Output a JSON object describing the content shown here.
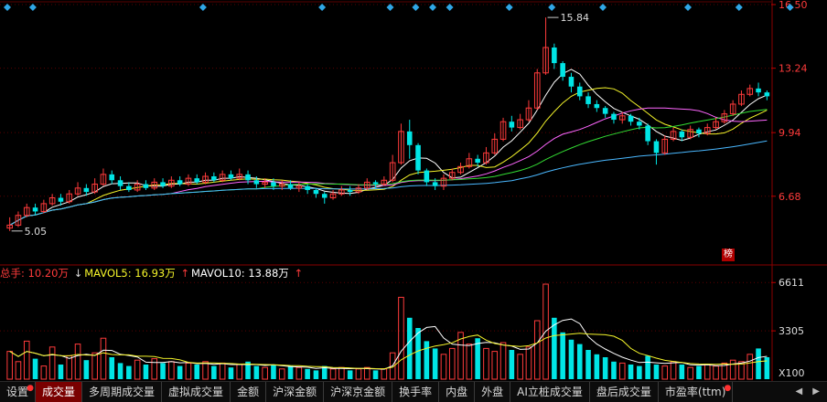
{
  "chart_data": {
    "type": "candlestick+volume",
    "price_axis": {
      "ticks": [
        16.5,
        13.24,
        9.94,
        6.68
      ],
      "labels": [
        "16.50",
        "13.24",
        "9.94",
        "6.68"
      ]
    },
    "annotations": {
      "high_label": "15.84",
      "low_label": "5.05"
    },
    "candles": [
      [
        5.05,
        5.2,
        5.6,
        4.9
      ],
      [
        5.2,
        5.7,
        5.9,
        5.1
      ],
      [
        5.7,
        6.1,
        6.3,
        5.6
      ],
      [
        6.1,
        5.9,
        6.3,
        5.7
      ],
      [
        5.9,
        6.3,
        6.5,
        5.8
      ],
      [
        6.3,
        6.6,
        6.8,
        6.2
      ],
      [
        6.6,
        6.4,
        6.8,
        6.2
      ],
      [
        6.4,
        6.8,
        7.0,
        6.3
      ],
      [
        6.8,
        7.1,
        7.4,
        6.7
      ],
      [
        7.1,
        6.9,
        7.3,
        6.7
      ],
      [
        6.9,
        7.3,
        7.6,
        6.8
      ],
      [
        7.3,
        7.8,
        8.1,
        7.2
      ],
      [
        7.8,
        7.5,
        8.0,
        7.3
      ],
      [
        7.5,
        7.2,
        7.7,
        7.0
      ],
      [
        7.2,
        7.0,
        7.4,
        6.9
      ],
      [
        7.0,
        7.3,
        7.5,
        6.9
      ],
      [
        7.3,
        7.1,
        7.5,
        7.0
      ],
      [
        7.1,
        7.4,
        7.6,
        7.0
      ],
      [
        7.4,
        7.2,
        7.6,
        7.1
      ],
      [
        7.2,
        7.5,
        7.7,
        7.1
      ],
      [
        7.5,
        7.3,
        7.7,
        7.2
      ],
      [
        7.3,
        7.6,
        7.8,
        7.2
      ],
      [
        7.6,
        7.4,
        7.8,
        7.3
      ],
      [
        7.4,
        7.7,
        7.9,
        7.3
      ],
      [
        7.7,
        7.5,
        7.9,
        7.4
      ],
      [
        7.5,
        7.8,
        8.0,
        7.4
      ],
      [
        7.8,
        7.6,
        8.0,
        7.5
      ],
      [
        7.6,
        7.8,
        8.1,
        7.5
      ],
      [
        7.8,
        7.5,
        8.0,
        7.3
      ],
      [
        7.5,
        7.3,
        7.7,
        7.1
      ],
      [
        7.3,
        7.4,
        7.6,
        7.1
      ],
      [
        7.4,
        7.2,
        7.6,
        7.0
      ],
      [
        7.2,
        7.3,
        7.5,
        7.0
      ],
      [
        7.3,
        7.1,
        7.5,
        7.0
      ],
      [
        7.1,
        7.2,
        7.4,
        6.9
      ],
      [
        7.2,
        7.0,
        7.3,
        6.8
      ],
      [
        7.0,
        6.8,
        7.1,
        6.6
      ],
      [
        6.8,
        6.6,
        6.9,
        6.3
      ],
      [
        6.6,
        6.8,
        7.0,
        6.5
      ],
      [
        6.8,
        7.0,
        7.2,
        6.7
      ],
      [
        7.0,
        6.9,
        7.2,
        6.7
      ],
      [
        6.9,
        7.1,
        7.3,
        6.8
      ],
      [
        7.1,
        7.4,
        7.6,
        7.0
      ],
      [
        7.4,
        7.3,
        7.5,
        7.1
      ],
      [
        7.3,
        7.5,
        7.7,
        7.2
      ],
      [
        7.5,
        8.4,
        8.8,
        7.4
      ],
      [
        8.4,
        10.0,
        10.4,
        8.3
      ],
      [
        10.0,
        9.3,
        10.6,
        8.6
      ],
      [
        9.3,
        8.0,
        9.4,
        7.8
      ],
      [
        8.0,
        7.4,
        8.1,
        7.2
      ],
      [
        7.4,
        7.2,
        7.6,
        7.0
      ],
      [
        7.2,
        7.6,
        7.8,
        7.0
      ],
      [
        7.6,
        7.9,
        8.1,
        7.5
      ],
      [
        7.9,
        8.2,
        8.4,
        7.8
      ],
      [
        8.2,
        8.6,
        8.9,
        8.1
      ],
      [
        8.6,
        8.4,
        8.8,
        8.2
      ],
      [
        8.4,
        8.9,
        9.2,
        8.3
      ],
      [
        8.9,
        9.6,
        9.9,
        8.8
      ],
      [
        9.6,
        10.5,
        10.7,
        9.5
      ],
      [
        10.5,
        10.2,
        10.8,
        10.0
      ],
      [
        10.2,
        10.6,
        10.9,
        10.1
      ],
      [
        10.6,
        11.2,
        11.6,
        10.5
      ],
      [
        11.2,
        13.0,
        13.2,
        11.1
      ],
      [
        13.0,
        14.3,
        15.84,
        12.9
      ],
      [
        14.3,
        13.5,
        14.5,
        13.2
      ],
      [
        13.5,
        12.8,
        13.6,
        12.6
      ],
      [
        12.8,
        12.3,
        13.0,
        12.0
      ],
      [
        12.3,
        11.8,
        12.5,
        11.6
      ],
      [
        11.8,
        11.4,
        12.0,
        11.2
      ],
      [
        11.4,
        11.2,
        11.6,
        11.0
      ],
      [
        11.2,
        10.9,
        11.3,
        10.7
      ],
      [
        10.9,
        10.6,
        11.0,
        10.4
      ],
      [
        10.6,
        10.8,
        11.0,
        10.4
      ],
      [
        10.8,
        10.5,
        10.9,
        10.3
      ],
      [
        10.5,
        10.3,
        10.7,
        10.1
      ],
      [
        10.3,
        9.5,
        10.4,
        9.3
      ],
      [
        9.5,
        8.9,
        9.6,
        8.3
      ],
      [
        8.9,
        9.6,
        9.8,
        8.8
      ],
      [
        9.6,
        10.0,
        10.2,
        9.5
      ],
      [
        10.0,
        9.7,
        10.1,
        9.5
      ],
      [
        9.7,
        10.1,
        10.3,
        9.6
      ],
      [
        10.1,
        9.9,
        10.2,
        9.7
      ],
      [
        9.9,
        10.2,
        10.4,
        9.8
      ],
      [
        10.2,
        10.5,
        10.7,
        10.1
      ],
      [
        10.5,
        10.9,
        11.1,
        10.4
      ],
      [
        10.9,
        11.4,
        11.6,
        10.8
      ],
      [
        11.4,
        11.9,
        12.1,
        11.3
      ],
      [
        11.9,
        12.2,
        12.4,
        11.8
      ],
      [
        12.2,
        12.0,
        12.5,
        11.8
      ],
      [
        12.0,
        11.8,
        12.1,
        11.6
      ]
    ],
    "volume": [
      1900,
      1200,
      2600,
      1400,
      900,
      2200,
      1000,
      1600,
      2400,
      1300,
      1800,
      2800,
      1500,
      1100,
      900,
      1300,
      1000,
      1400,
      1100,
      1200,
      900,
      1100,
      1000,
      1200,
      900,
      1100,
      800,
      1000,
      1200,
      900,
      800,
      1000,
      700,
      900,
      800,
      700,
      600,
      900,
      700,
      800,
      600,
      700,
      800,
      600,
      700,
      1800,
      5600,
      4200,
      3500,
      2600,
      2100,
      1700,
      2100,
      3200,
      2400,
      2800,
      2100,
      1900,
      2500,
      2000,
      1700,
      2200,
      4000,
      6500,
      4200,
      3200,
      2700,
      2400,
      2000,
      1700,
      1500,
      1200,
      1100,
      1000,
      900,
      1600,
      1000,
      900,
      1200,
      1000,
      800,
      900,
      1000,
      900,
      1100,
      1300,
      1200,
      1700,
      2100,
      1500
    ],
    "volume_axis": {
      "ticks": [
        6611,
        3305
      ],
      "labels": [
        "6611",
        "3305"
      ],
      "unit": "X100"
    },
    "volume_legend": {
      "total_label": "总手: 10.20万",
      "mavol5_label": "MAVOL5: 16.93万",
      "mavol5_arrow": "↓",
      "mavol10_label": "MAVOL10: 13.88万",
      "mavol10_arrow": "↑",
      "tail_arrow": "↑"
    },
    "colors": {
      "up": "#ff3b3b",
      "down": "#00e5e5",
      "ma_white": "#ffffff",
      "ma_yellow": "#f5f52a",
      "ma_pink": "#ff66ff",
      "ma_green": "#33dd33",
      "ma_blue": "#4ab8ff",
      "axis_label": "#ff3b3b",
      "event_marker": "#2fa6e6"
    },
    "event_markers": 14
  },
  "tabs": [
    {
      "label": "设置",
      "dot": true
    },
    {
      "label": "成交量",
      "active": true
    },
    {
      "label": "多周期成交量"
    },
    {
      "label": "虚拟成交量"
    },
    {
      "label": "金额"
    },
    {
      "label": "沪深金额"
    },
    {
      "label": "沪深京金额"
    },
    {
      "label": "换手率"
    },
    {
      "label": "内盘"
    },
    {
      "label": "外盘"
    },
    {
      "label": "AI立桩成交量"
    },
    {
      "label": "盘后成交量"
    },
    {
      "label": "市盈率(ttm)",
      "dot": true
    }
  ],
  "tab_arrows": "◀ ▶",
  "badge": "榜"
}
